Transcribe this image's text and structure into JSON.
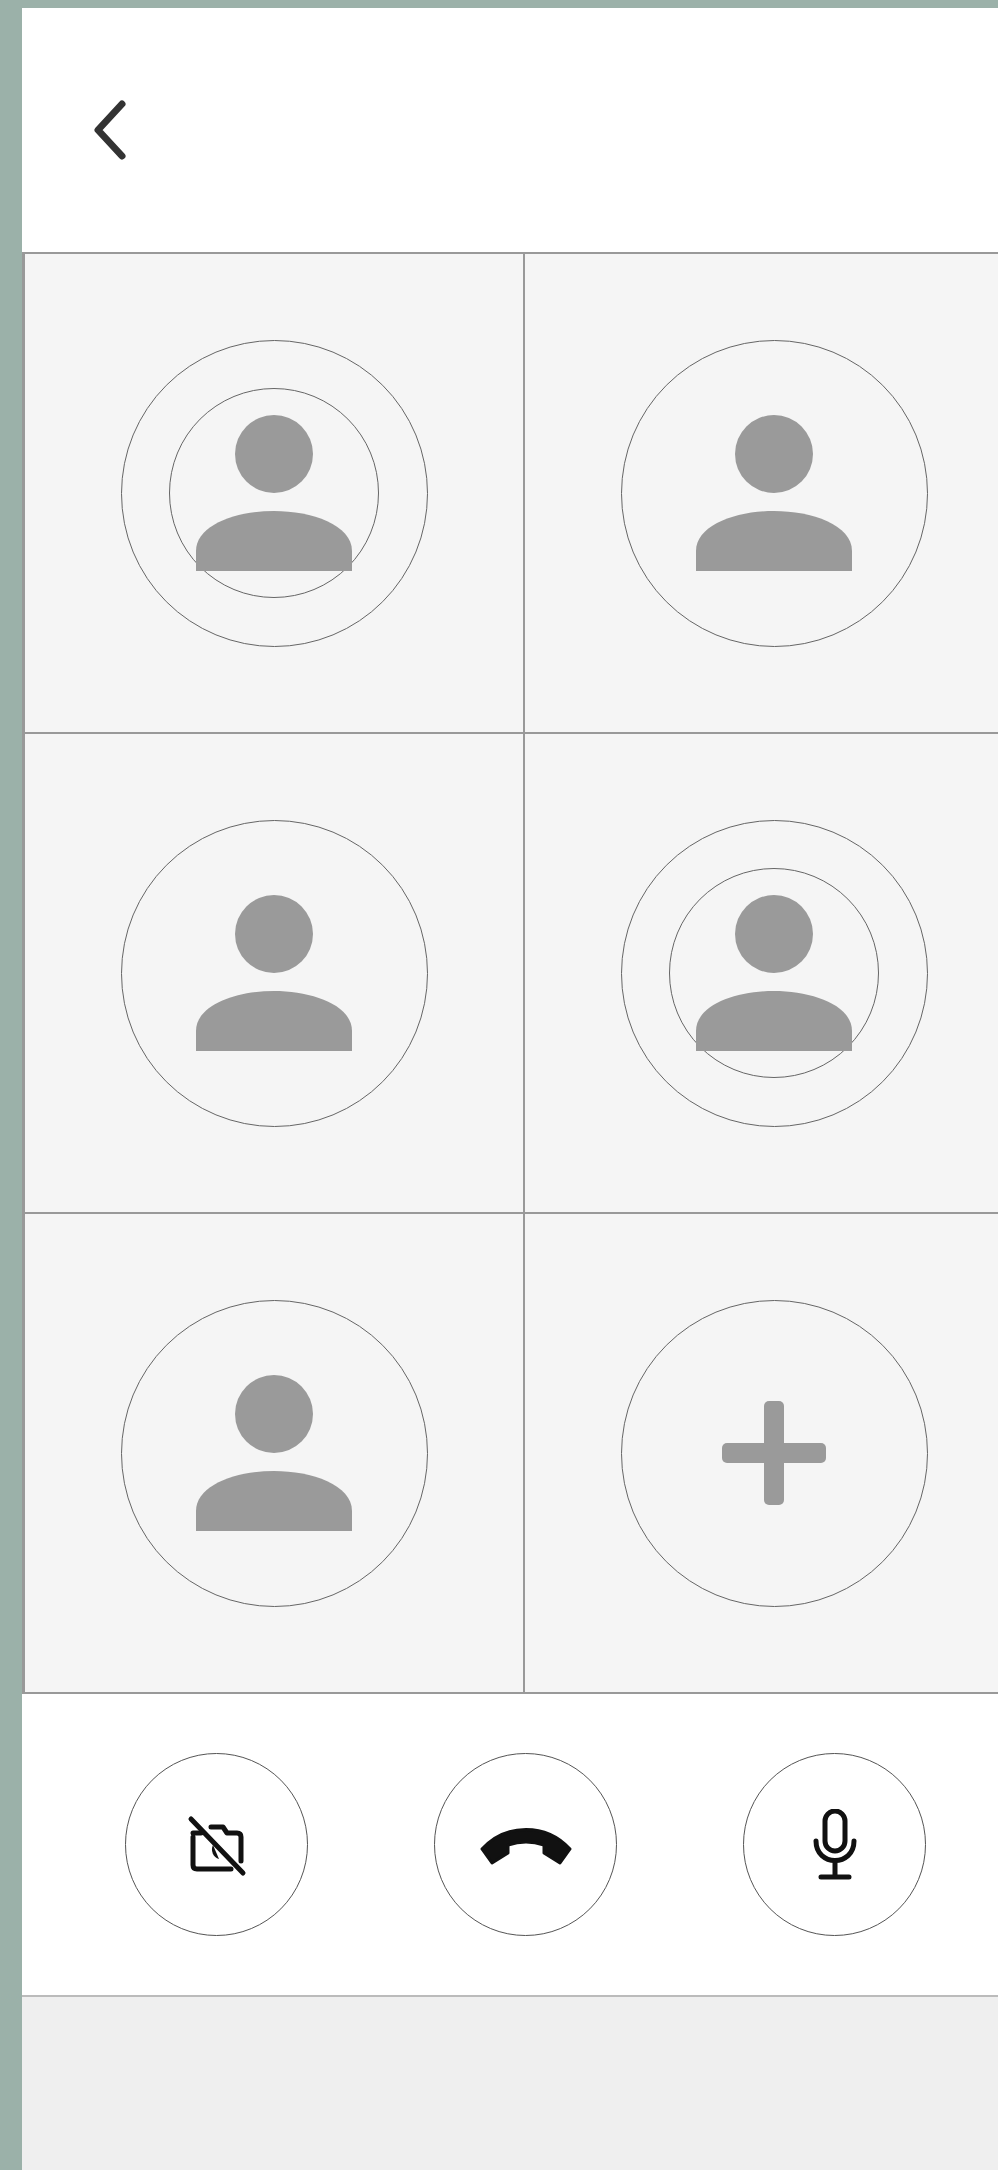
{
  "tiles": [
    {
      "kind": "person",
      "speaking": true
    },
    {
      "kind": "person",
      "speaking": false
    },
    {
      "kind": "person",
      "speaking": false
    },
    {
      "kind": "person",
      "speaking": true
    },
    {
      "kind": "person",
      "speaking": false
    },
    {
      "kind": "add"
    }
  ],
  "controls": [
    {
      "kind": "camera_off"
    },
    {
      "kind": "hang_up"
    },
    {
      "kind": "mic"
    }
  ]
}
